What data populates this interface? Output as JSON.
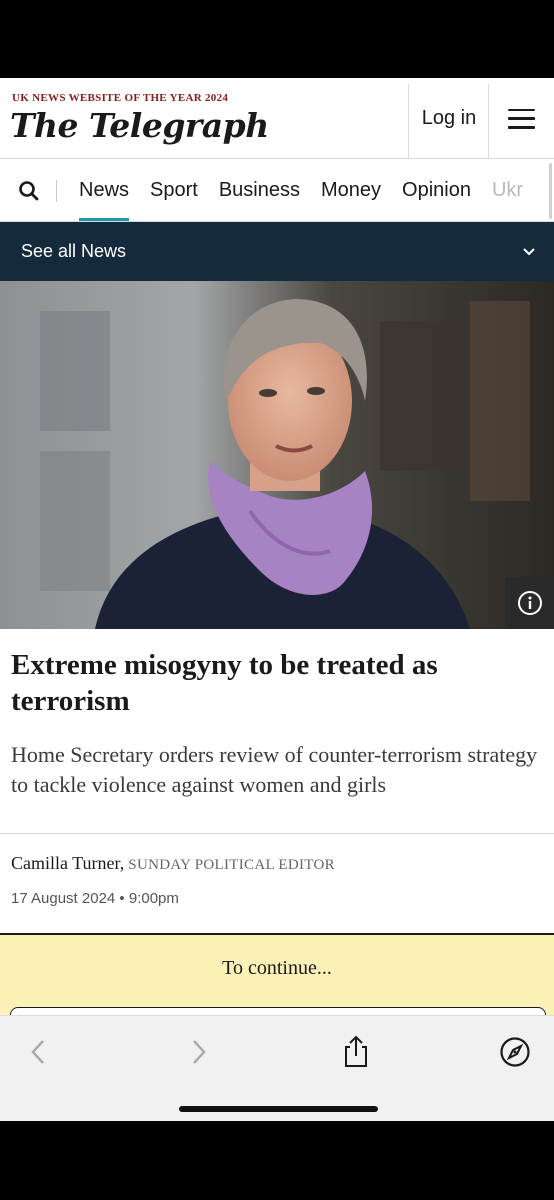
{
  "header": {
    "award": "UK NEWS WEBSITE OF THE YEAR 2024",
    "logo": "The Telegraph",
    "login_label": "Log in",
    "menu_icon": "hamburger-menu-icon"
  },
  "nav": {
    "search_icon": "search-icon",
    "items": [
      {
        "label": "News",
        "active": true
      },
      {
        "label": "Sport"
      },
      {
        "label": "Business"
      },
      {
        "label": "Money"
      },
      {
        "label": "Opinion"
      },
      {
        "label": "Ukr"
      }
    ]
  },
  "subnav": {
    "label": "See all News",
    "icon": "chevron-down-icon"
  },
  "hero": {
    "info_icon": "info-icon"
  },
  "article": {
    "headline": "Extreme misogyny to be treated as terrorism",
    "standfirst": "Home Secretary orders review of counter-terrorism strategy to tackle violence against women and girls",
    "author": "Camilla Turner,",
    "author_role": "SUNDAY POLITICAL EDITOR",
    "date": "17 August 2024 • 9:00pm"
  },
  "paywall": {
    "text": "To continue..."
  },
  "browser": {
    "back_icon": "back-arrow-icon",
    "forward_icon": "forward-arrow-icon",
    "share_icon": "share-icon",
    "compass_icon": "compass-icon"
  },
  "colors": {
    "accent_teal": "#1a9ca4",
    "subnav_bg": "#162a3d",
    "paywall_bg": "#fbf1b6",
    "award_red": "#8a1c1c"
  }
}
